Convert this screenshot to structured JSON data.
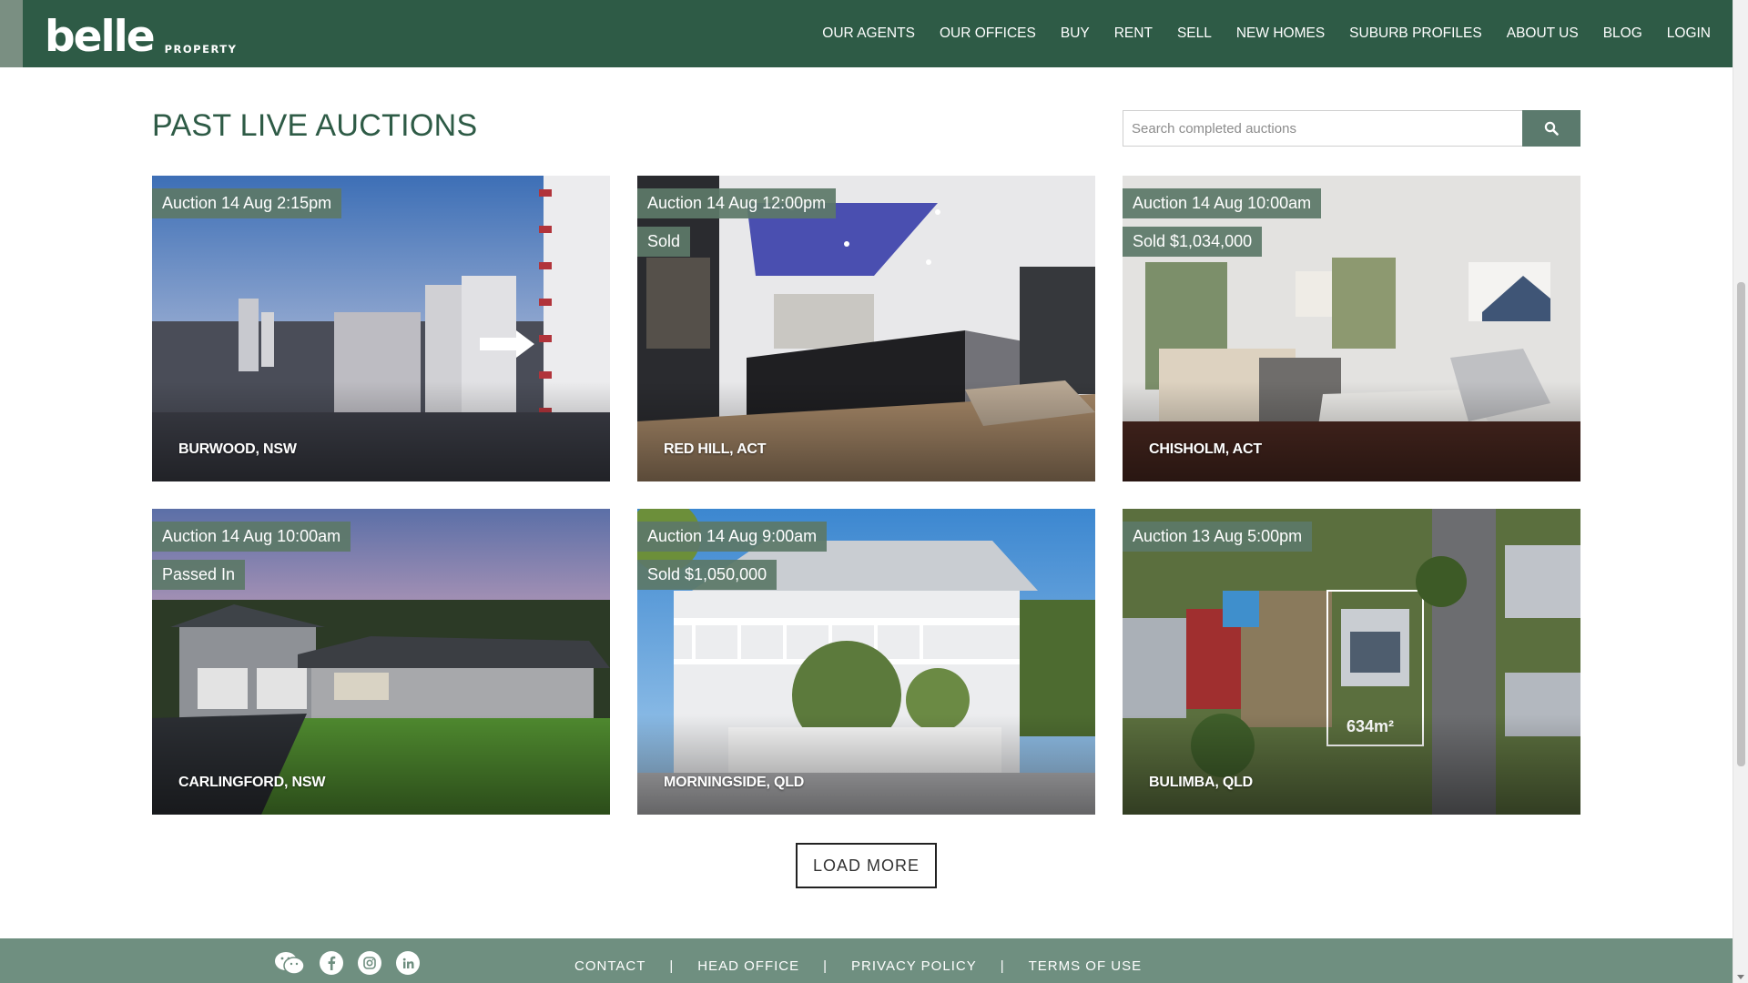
{
  "header": {
    "logo_word": "belle",
    "logo_sub": "PROPERTY",
    "nav": [
      "OUR AGENTS",
      "OUR OFFICES",
      "BUY",
      "RENT",
      "SELL",
      "NEW HOMES",
      "SUBURB PROFILES",
      "ABOUT US",
      "BLOG",
      "LOGIN"
    ]
  },
  "main": {
    "title": "PAST LIVE AUCTIONS",
    "search": {
      "placeholder": "Search completed auctions",
      "button_icon": "search-icon"
    },
    "cards": [
      {
        "auction": "Auction 14 Aug 2:15pm",
        "status": "",
        "location": "BURWOOD, NSW"
      },
      {
        "auction": "Auction 14 Aug 12:00pm",
        "status": "Sold",
        "location": "RED HILL, ACT"
      },
      {
        "auction": "Auction 14 Aug 10:00am",
        "status": "Sold $1,034,000",
        "location": "CHISHOLM, ACT"
      },
      {
        "auction": "Auction 14 Aug 10:00am",
        "status": "Passed In",
        "location": "CARLINGFORD, NSW"
      },
      {
        "auction": "Auction 14 Aug 9:00am",
        "status": "Sold $1,050,000",
        "location": "MORNINGSIDE, QLD"
      },
      {
        "auction": "Auction 13 Aug 5:00pm",
        "status": "",
        "location": "BULIMBA, QLD"
      }
    ],
    "load_more": "LOAD MORE"
  },
  "footer": {
    "social": [
      "wechat-icon",
      "facebook-icon",
      "instagram-icon",
      "linkedin-icon"
    ],
    "links": [
      "CONTACT",
      "HEAD OFFICE",
      "PRIVACY POLICY",
      "TERMS OF USE"
    ],
    "separator": "|"
  },
  "colors": {
    "header_bg": "#2e5b46",
    "accent": "#5b7a6d",
    "badge_bg": "#5c7868",
    "footer_bg": "#6f8f80"
  }
}
